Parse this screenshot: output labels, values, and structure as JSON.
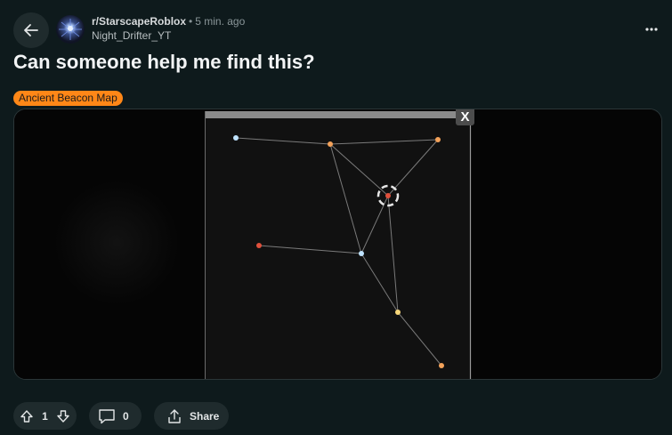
{
  "post": {
    "subreddit": "r/StarscapeRoblox",
    "separator": "•",
    "time": "5 min. ago",
    "username": "Night_Drifter_YT",
    "title": "Can someone help me find this?",
    "flair": "Ancient Beacon Map"
  },
  "media": {
    "close_label": "X"
  },
  "actions": {
    "upvotes": "1",
    "comments": "0",
    "share_label": "Share"
  },
  "colors": {
    "background": "#0e1a1c",
    "flair": "#ff8717",
    "node_orange": "#f4a25a",
    "node_blue": "#bfe3ff",
    "node_red": "#e0503c",
    "node_yellow": "#f7d77a"
  }
}
